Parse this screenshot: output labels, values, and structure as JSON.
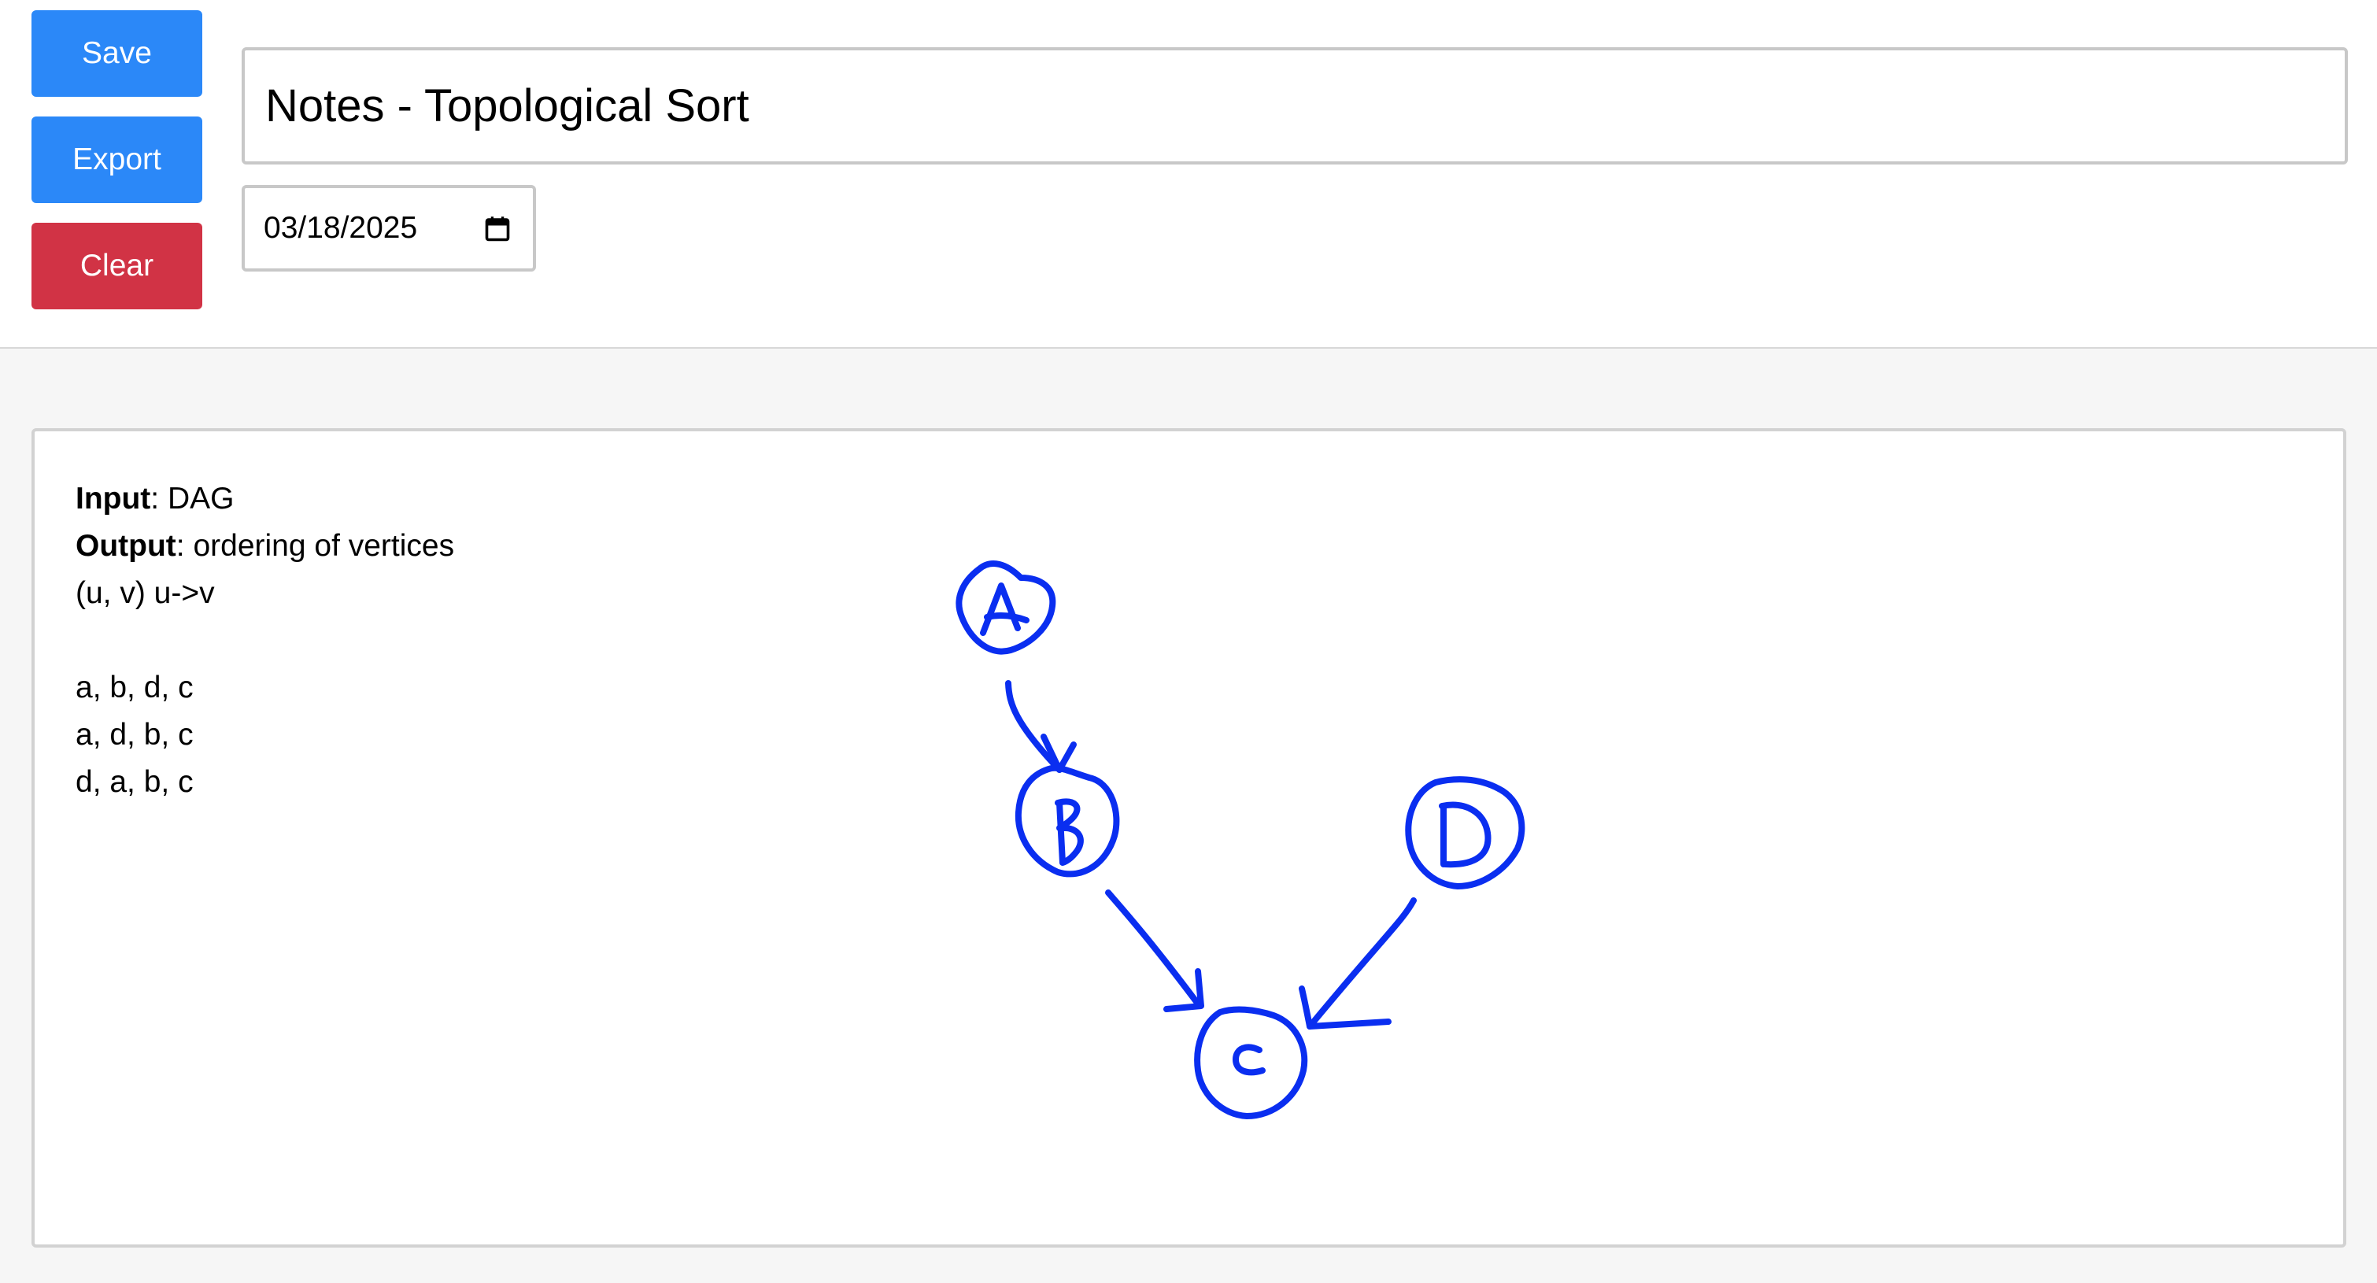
{
  "toolbar": {
    "save_label": "Save",
    "export_label": "Export",
    "clear_label": "Clear"
  },
  "note": {
    "title": "Notes - Topological Sort",
    "date": "03/18/2025"
  },
  "notes_text": {
    "input_label": "Input",
    "input_value": ": DAG",
    "output_label": "Output",
    "output_value": ": ordering of vertices",
    "edge_line": "(u, v) u->v",
    "orderings": [
      "a, b, d, c",
      "a, d, b, c",
      "d, a, b, c"
    ]
  },
  "sketch": {
    "ink_color": "#0a2ef0",
    "node_labels": [
      "A",
      "B",
      "D",
      "C"
    ]
  },
  "colors": {
    "primary": "#2b88f8",
    "danger": "#d13345"
  },
  "icons": {
    "date_picker": "calendar-icon"
  }
}
